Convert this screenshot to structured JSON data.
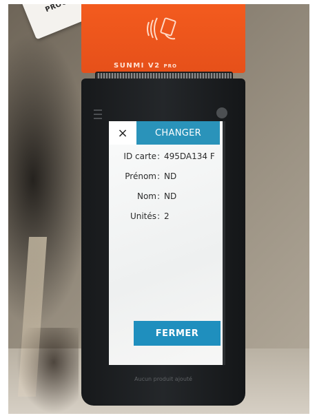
{
  "paper_card": {
    "text": "PROGRAM"
  },
  "device": {
    "brand": "SUNMI V2",
    "brand_suffix": "PRO",
    "footer_text": "Aucun produit ajouté"
  },
  "dialog": {
    "close_symbol": "×",
    "title": "CHANGER",
    "fields": [
      {
        "label": "ID carte",
        "value": "495DA134 F"
      },
      {
        "label": "Prénom",
        "value": "ND"
      },
      {
        "label": "Nom",
        "value": "ND"
      },
      {
        "label": "Unités",
        "value": "2"
      }
    ],
    "action_label": "FERMER"
  },
  "colors": {
    "device_orange": "#f35b1e",
    "dialog_accent": "#2a93ba"
  }
}
